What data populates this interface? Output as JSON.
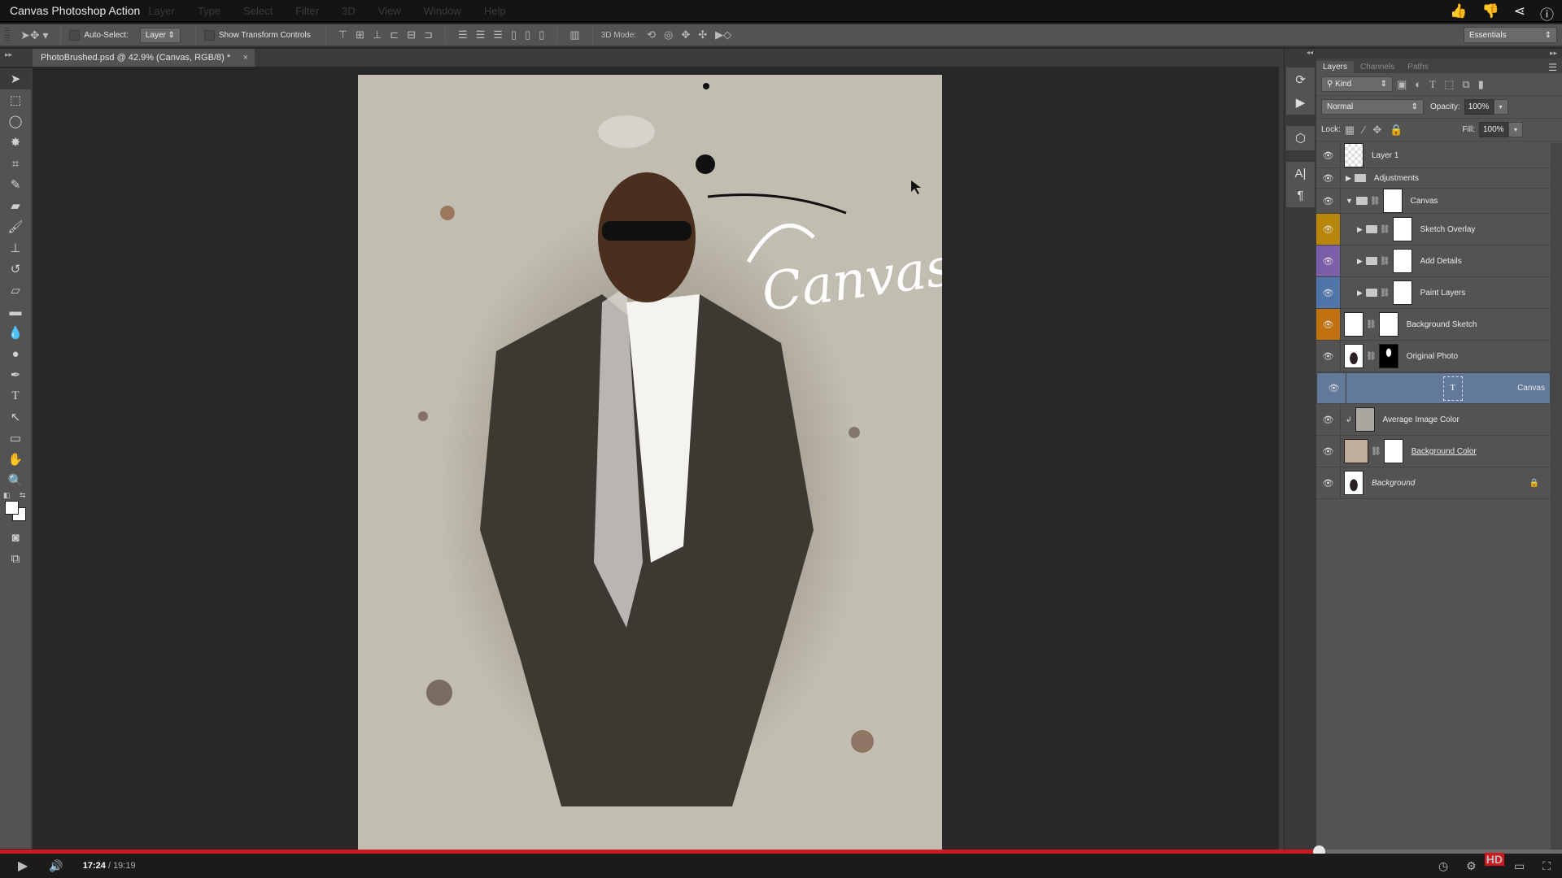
{
  "menubar": {
    "title": "Canvas Photoshop Action",
    "menus": [
      "Layer",
      "Type",
      "Select",
      "Filter",
      "3D",
      "View",
      "Window",
      "Help"
    ],
    "overlay_icons": [
      "thumbs-up-icon",
      "thumbs-down-icon",
      "share-icon",
      "info-icon"
    ]
  },
  "options": {
    "auto_select_label": "Auto-Select:",
    "auto_select_checked": false,
    "auto_select_target": "Layer",
    "show_transform_label": "Show Transform Controls",
    "show_transform_checked": false,
    "mode_3d_label": "3D Mode:",
    "workspace": "Essentials"
  },
  "document": {
    "tab_title": "PhotoBrushed.psd @ 42.9% (Canvas, RGB/8) *",
    "close": "×",
    "canvas_text": "Canvas"
  },
  "tools": [
    "move",
    "marquee",
    "lasso",
    "magic-wand",
    "crop",
    "eyedropper",
    "healing-brush",
    "brush",
    "clone-stamp",
    "history-brush",
    "eraser",
    "gradient",
    "blur",
    "dodge",
    "pen",
    "type",
    "path-selection",
    "rectangle",
    "hand",
    "zoom"
  ],
  "panel": {
    "tabs": [
      "Layers",
      "Channels",
      "Paths"
    ],
    "active_tab": "Layers",
    "filter_kind": "Kind",
    "blend_mode": "Normal",
    "opacity_label": "Opacity:",
    "opacity": "100%",
    "lock_label": "Lock:",
    "fill_label": "Fill:",
    "fill": "100%",
    "layers": [
      {
        "name": "Layer 1",
        "type": "pixel",
        "indent": 0,
        "color": "",
        "selected": false
      },
      {
        "name": "Adjustments",
        "type": "group-collapsed",
        "indent": 0,
        "color": "",
        "selected": false
      },
      {
        "name": "Canvas",
        "type": "group-expanded",
        "indent": 0,
        "color": "",
        "selected": false
      },
      {
        "name": "Sketch Overlay",
        "type": "group-collapsed",
        "indent": 1,
        "color": "#b8860b",
        "selected": false
      },
      {
        "name": "Add Details",
        "type": "group-collapsed",
        "indent": 1,
        "color": "#7a5fa8",
        "selected": false
      },
      {
        "name": "Paint Layers",
        "type": "group-collapsed",
        "indent": 1,
        "color": "#4f75a8",
        "selected": false
      },
      {
        "name": "Background Sketch",
        "type": "pixel-mask",
        "indent": 0,
        "color": "#c0700c",
        "selected": false
      },
      {
        "name": "Original Photo",
        "type": "pixel-mask",
        "indent": 0,
        "color": "",
        "selected": false
      },
      {
        "name": "Canvas",
        "type": "text",
        "indent": 0,
        "color": "",
        "selected": true
      },
      {
        "name": "Average Image Color",
        "type": "clipped-fill",
        "indent": 0,
        "color": "",
        "selected": false
      },
      {
        "name": "Background Color",
        "type": "fill-mask",
        "indent": 0,
        "color": "",
        "selected": false
      },
      {
        "name": "Background",
        "type": "background",
        "indent": 0,
        "color": "",
        "selected": false,
        "locked": true
      }
    ]
  },
  "player": {
    "current": "17:24",
    "separator": " / ",
    "duration": "19:19",
    "progress": 0.9008,
    "hd_badge": "HD"
  }
}
